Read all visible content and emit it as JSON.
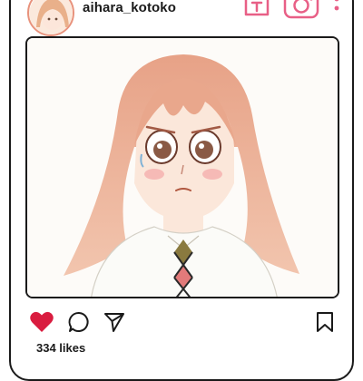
{
  "profile": {
    "username": "aihara_kotoko"
  },
  "header_icons": [
    "igtv-icon",
    "camera-icon",
    "more-options-icon"
  ],
  "post": {
    "image_alt": "aihara_kotoko post"
  },
  "actions": {
    "liked": true,
    "icons": [
      "heart-icon",
      "comment-icon",
      "share-icon",
      "bookmark-icon"
    ]
  },
  "likes_text": "334 likes",
  "colors": {
    "accent": "#e85f86",
    "heart": "#d91c3f",
    "avatar_ring": "#e8927c",
    "outline": "#1a1a1a"
  }
}
